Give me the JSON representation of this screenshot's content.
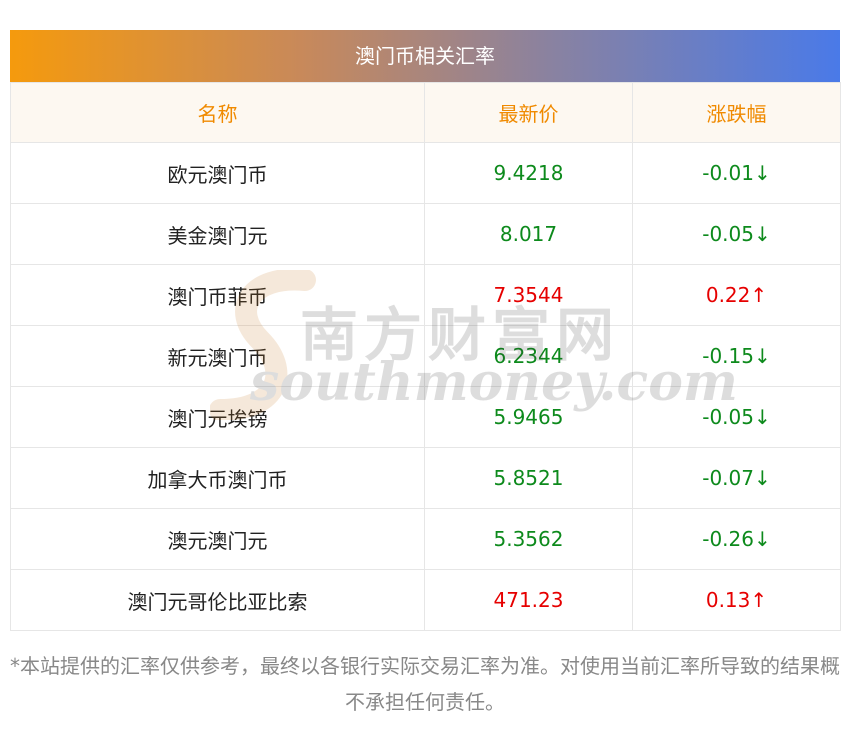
{
  "title": "澳门币相关汇率",
  "headers": [
    "名称",
    "最新价",
    "涨跌幅"
  ],
  "rows": [
    {
      "name": "欧元澳门币",
      "price": "9.4218",
      "change": "-0.01↓",
      "dir": "down"
    },
    {
      "name": "美金澳门元",
      "price": "8.017",
      "change": "-0.05↓",
      "dir": "down"
    },
    {
      "name": "澳门币菲币",
      "price": "7.3544",
      "change": "0.22↑",
      "dir": "up"
    },
    {
      "name": "新元澳门币",
      "price": "6.2344",
      "change": "-0.15↓",
      "dir": "down"
    },
    {
      "name": "澳门元埃镑",
      "price": "5.9465",
      "change": "-0.05↓",
      "dir": "down"
    },
    {
      "name": "加拿大币澳门币",
      "price": "5.8521",
      "change": "-0.07↓",
      "dir": "down"
    },
    {
      "name": "澳元澳门元",
      "price": "5.3562",
      "change": "-0.26↓",
      "dir": "down"
    },
    {
      "name": "澳门元哥伦比亚比索",
      "price": "471.23",
      "change": "0.13↑",
      "dir": "up"
    }
  ],
  "watermark": {
    "cn": "南方财富网",
    "en": "southmoney.com"
  },
  "footer": "*本站提供的汇率仅供参考，最终以各银行实际交易汇率为准。对使用当前汇率所导致的结果概不承担任何责任。",
  "colors": {
    "up": "#e60000",
    "down": "#0d8a1c",
    "header_text": "#f08a00"
  }
}
